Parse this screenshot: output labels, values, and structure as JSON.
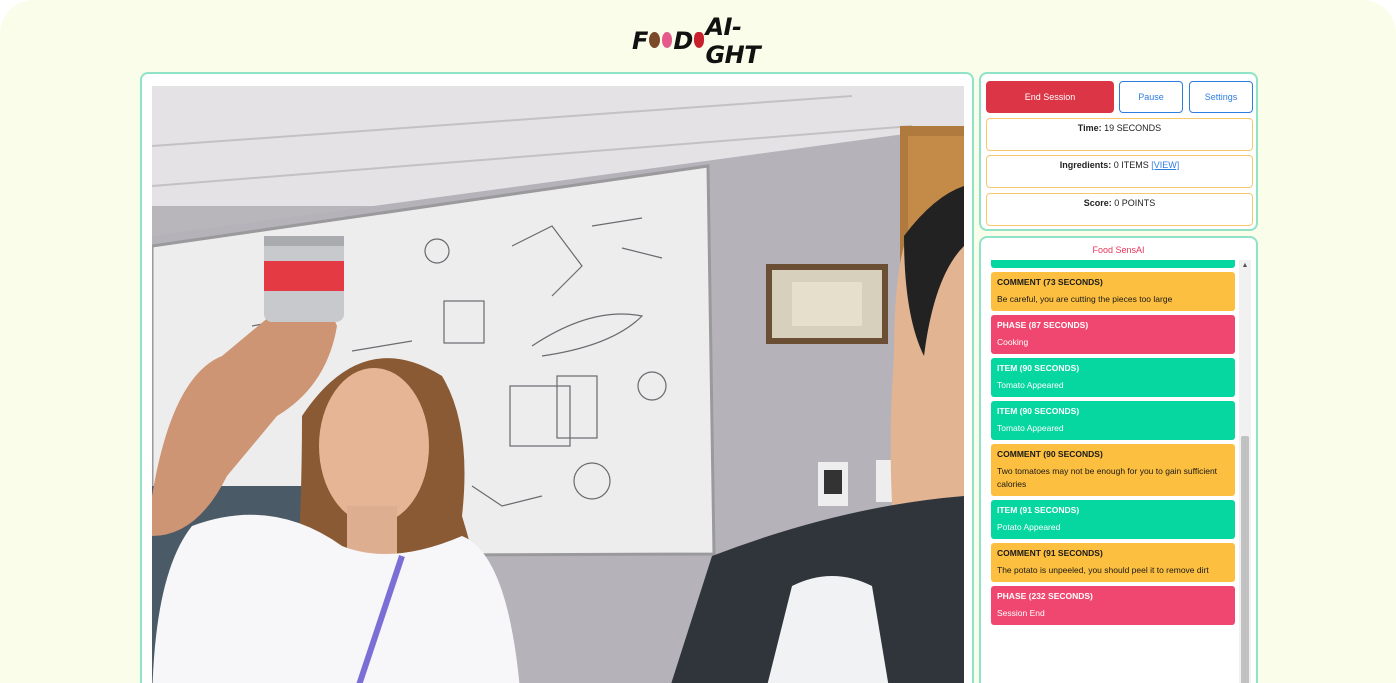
{
  "app": {
    "logo_text": "FOODFAI-GHT",
    "logo_parts": [
      "F",
      "D",
      "AI-GHT"
    ]
  },
  "controls": {
    "end_label": "End Session",
    "pause_label": "Pause",
    "settings_label": "Settings"
  },
  "stats": {
    "time_label": "Time:",
    "time_value": "19 SECONDS",
    "ingredients_label": "Ingredients:",
    "ingredients_value": "0 ITEMS",
    "ingredients_link": "[VIEW]",
    "score_label": "Score:",
    "score_value": "0 POINTS"
  },
  "feed": {
    "title": "Food SensAI",
    "entries": [
      {
        "type": "comment",
        "header": "COMMENT (73 SECONDS)",
        "text": "Be careful, you are cutting the pieces too large"
      },
      {
        "type": "phase",
        "header": "PHASE (87 SECONDS)",
        "text": "Cooking"
      },
      {
        "type": "item",
        "header": "ITEM (90 SECONDS)",
        "text": "Tomato Appeared"
      },
      {
        "type": "item",
        "header": "ITEM (90 SECONDS)",
        "text": "Tomato Appeared"
      },
      {
        "type": "comment",
        "header": "COMMENT (90 SECONDS)",
        "text": "Two tomatoes may not be enough for you to gain sufficient calories"
      },
      {
        "type": "item",
        "header": "ITEM (91 SECONDS)",
        "text": "Potato Appeared"
      },
      {
        "type": "comment",
        "header": "COMMENT (91 SECONDS)",
        "text": "The potato is unpeeled, you should peel it to remove dirt"
      },
      {
        "type": "phase",
        "header": "PHASE (232 SECONDS)",
        "text": "Session End"
      }
    ]
  },
  "colors": {
    "background": "#f9fde9",
    "panel_border": "#8fe3c7",
    "end_button": "#dc3545",
    "secondary_button": "#2f7de1",
    "comment": "#fcbf3f",
    "phase": "#ef476f",
    "item": "#06d6a0",
    "feed_title": "#e8365a"
  },
  "icons": {
    "scroll_up": "triangle-up-icon"
  }
}
